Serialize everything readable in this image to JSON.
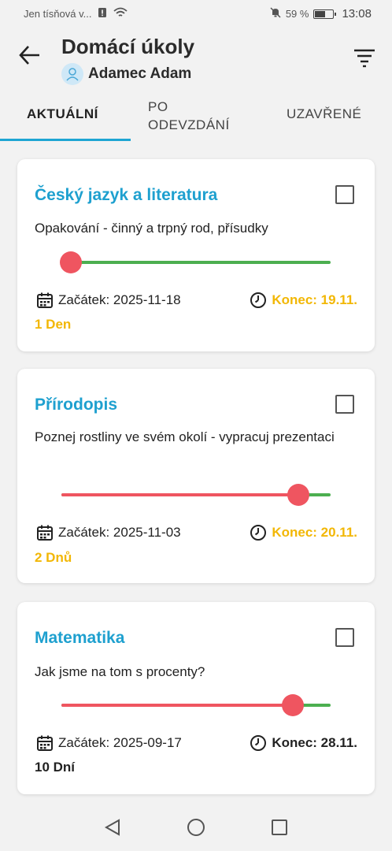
{
  "status_bar": {
    "carrier": "Jen tísňová v...",
    "battery_percent": "59 %",
    "battery_level": 0.59,
    "time": "13:08"
  },
  "header": {
    "title": "Domácí úkoly",
    "student_name": "Adamec Adam"
  },
  "tabs": [
    {
      "label": "AKTUÁLNÍ",
      "active": true
    },
    {
      "label": "PO\nODEVZDÁNÍ",
      "active": false
    },
    {
      "label": "UZAVŘENÉ",
      "active": false
    }
  ],
  "assignments": [
    {
      "subject": "Český jazyk a literatura",
      "description": "Opakování  - činný a trpný rod, přísudky",
      "progress": 0.0,
      "start": "Začátek: 2025-11-18",
      "end": "Konec: 19.11.",
      "days": "1 Den",
      "deadline_color": "#f2b705",
      "days_color": "#f2b705"
    },
    {
      "subject": "Přírodopis",
      "description": "Poznej rostliny ve svém okolí - vypracuj prezentaci",
      "progress": 0.88,
      "start": "Začátek: 2025-11-03",
      "end": "Konec: 20.11.",
      "days": "2 Dnů",
      "deadline_color": "#f2b705",
      "days_color": "#f2b705"
    },
    {
      "subject": "Matematika",
      "description": "Jak jsme na tom s procenty?",
      "progress": 0.86,
      "start": "Začátek: 2025-09-17",
      "end": "Konec: 28.11.",
      "days": "10 Dní",
      "deadline_color": "#222222",
      "days_color": "#222222"
    }
  ],
  "colors": {
    "accent": "#1ea0cf",
    "progress_done": "#ef5560",
    "progress_remaining": "#4caf50"
  },
  "icons": {
    "back": "arrow-left-icon",
    "filter": "filter-icon",
    "calendar": "calendar-icon",
    "clock": "clock-icon"
  }
}
